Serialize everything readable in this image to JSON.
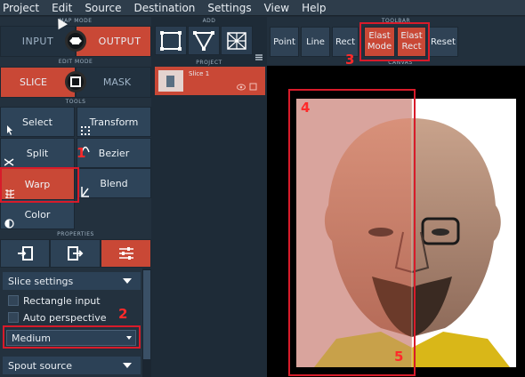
{
  "menu": [
    "Project",
    "Edit",
    "Source",
    "Destination",
    "Settings",
    "View",
    "Help"
  ],
  "map_mode": {
    "label": "MAP MODE",
    "input": "INPUT",
    "output": "OUTPUT",
    "active": "output"
  },
  "edit_mode": {
    "label": "EDIT MODE",
    "slice": "SLICE",
    "mask": "MASK",
    "active": "slice"
  },
  "tools": {
    "label": "TOOLS",
    "items": [
      "Select",
      "Transform",
      "Split",
      "Bezier",
      "Warp",
      "Blend",
      "Color"
    ],
    "active": "Warp"
  },
  "properties": {
    "label": "PROPERTIES",
    "slice_settings": "Slice settings",
    "rectangle_input": "Rectangle input",
    "auto_perspective": "Auto perspective",
    "quality_value": "Medium",
    "spout_source": "Spout source"
  },
  "add": {
    "label": "ADD"
  },
  "project": {
    "label": "PROJECT",
    "slice_name": "Slice 1"
  },
  "toolbar": {
    "label": "TOOLBAR",
    "buttons": [
      "Point",
      "Line",
      "Rect",
      "Elast Mode",
      "Elast Rect",
      "Reset"
    ]
  },
  "canvas": {
    "label": "CANVAS"
  },
  "callouts": [
    "1",
    "2",
    "3",
    "4",
    "5"
  ],
  "colors": {
    "accent": "#c94836",
    "panel": "#23313e",
    "button": "#2c4156",
    "callout": "#d81b2a"
  }
}
